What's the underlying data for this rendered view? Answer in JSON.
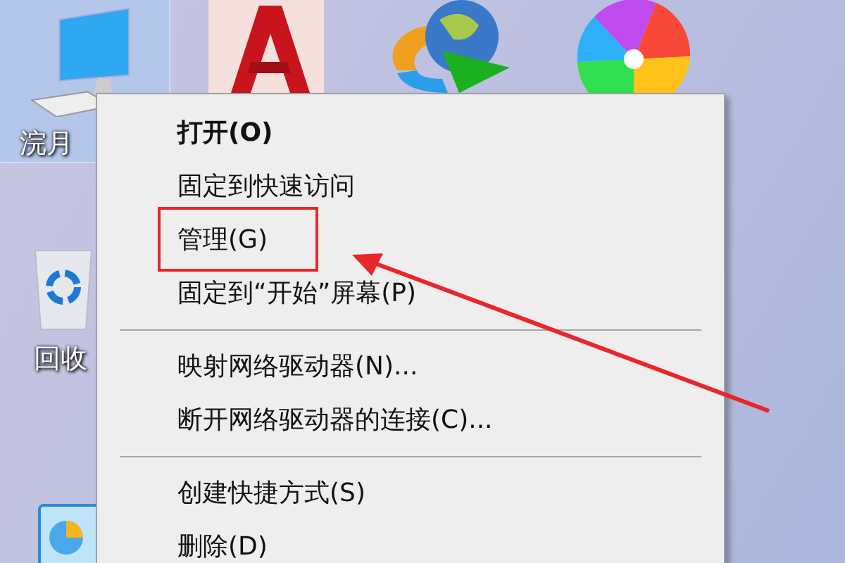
{
  "desktop_icons": [
    {
      "kind": "computer",
      "label": "浣月",
      "selected": true
    },
    {
      "kind": "recycle-bin",
      "label": "回收",
      "selected": false
    },
    {
      "kind": "chart-app",
      "selected": false
    },
    {
      "kind": "cad-app",
      "selected": false
    },
    {
      "kind": "download-app",
      "selected": false
    },
    {
      "kind": "browser-app",
      "selected": false
    }
  ],
  "context_menu": {
    "items": [
      {
        "kind": "item",
        "label": "打开(O)",
        "default": true,
        "annotated": false
      },
      {
        "kind": "item",
        "label": "固定到快速访问",
        "default": false,
        "annotated": false
      },
      {
        "kind": "item",
        "label": "管理(G)",
        "default": false,
        "annotated": true
      },
      {
        "kind": "item",
        "label": "固定到“开始”屏幕(P)",
        "default": false,
        "annotated": false
      },
      {
        "kind": "separator"
      },
      {
        "kind": "item",
        "label": "映射网络驱动器(N)...",
        "default": false,
        "annotated": false
      },
      {
        "kind": "item",
        "label": "断开网络驱动器的连接(C)...",
        "default": false,
        "annotated": false
      },
      {
        "kind": "separator"
      },
      {
        "kind": "item",
        "label": "创建快捷方式(S)",
        "default": false,
        "annotated": false
      },
      {
        "kind": "item",
        "label": "删除(D)",
        "default": false,
        "annotated": false
      }
    ]
  }
}
